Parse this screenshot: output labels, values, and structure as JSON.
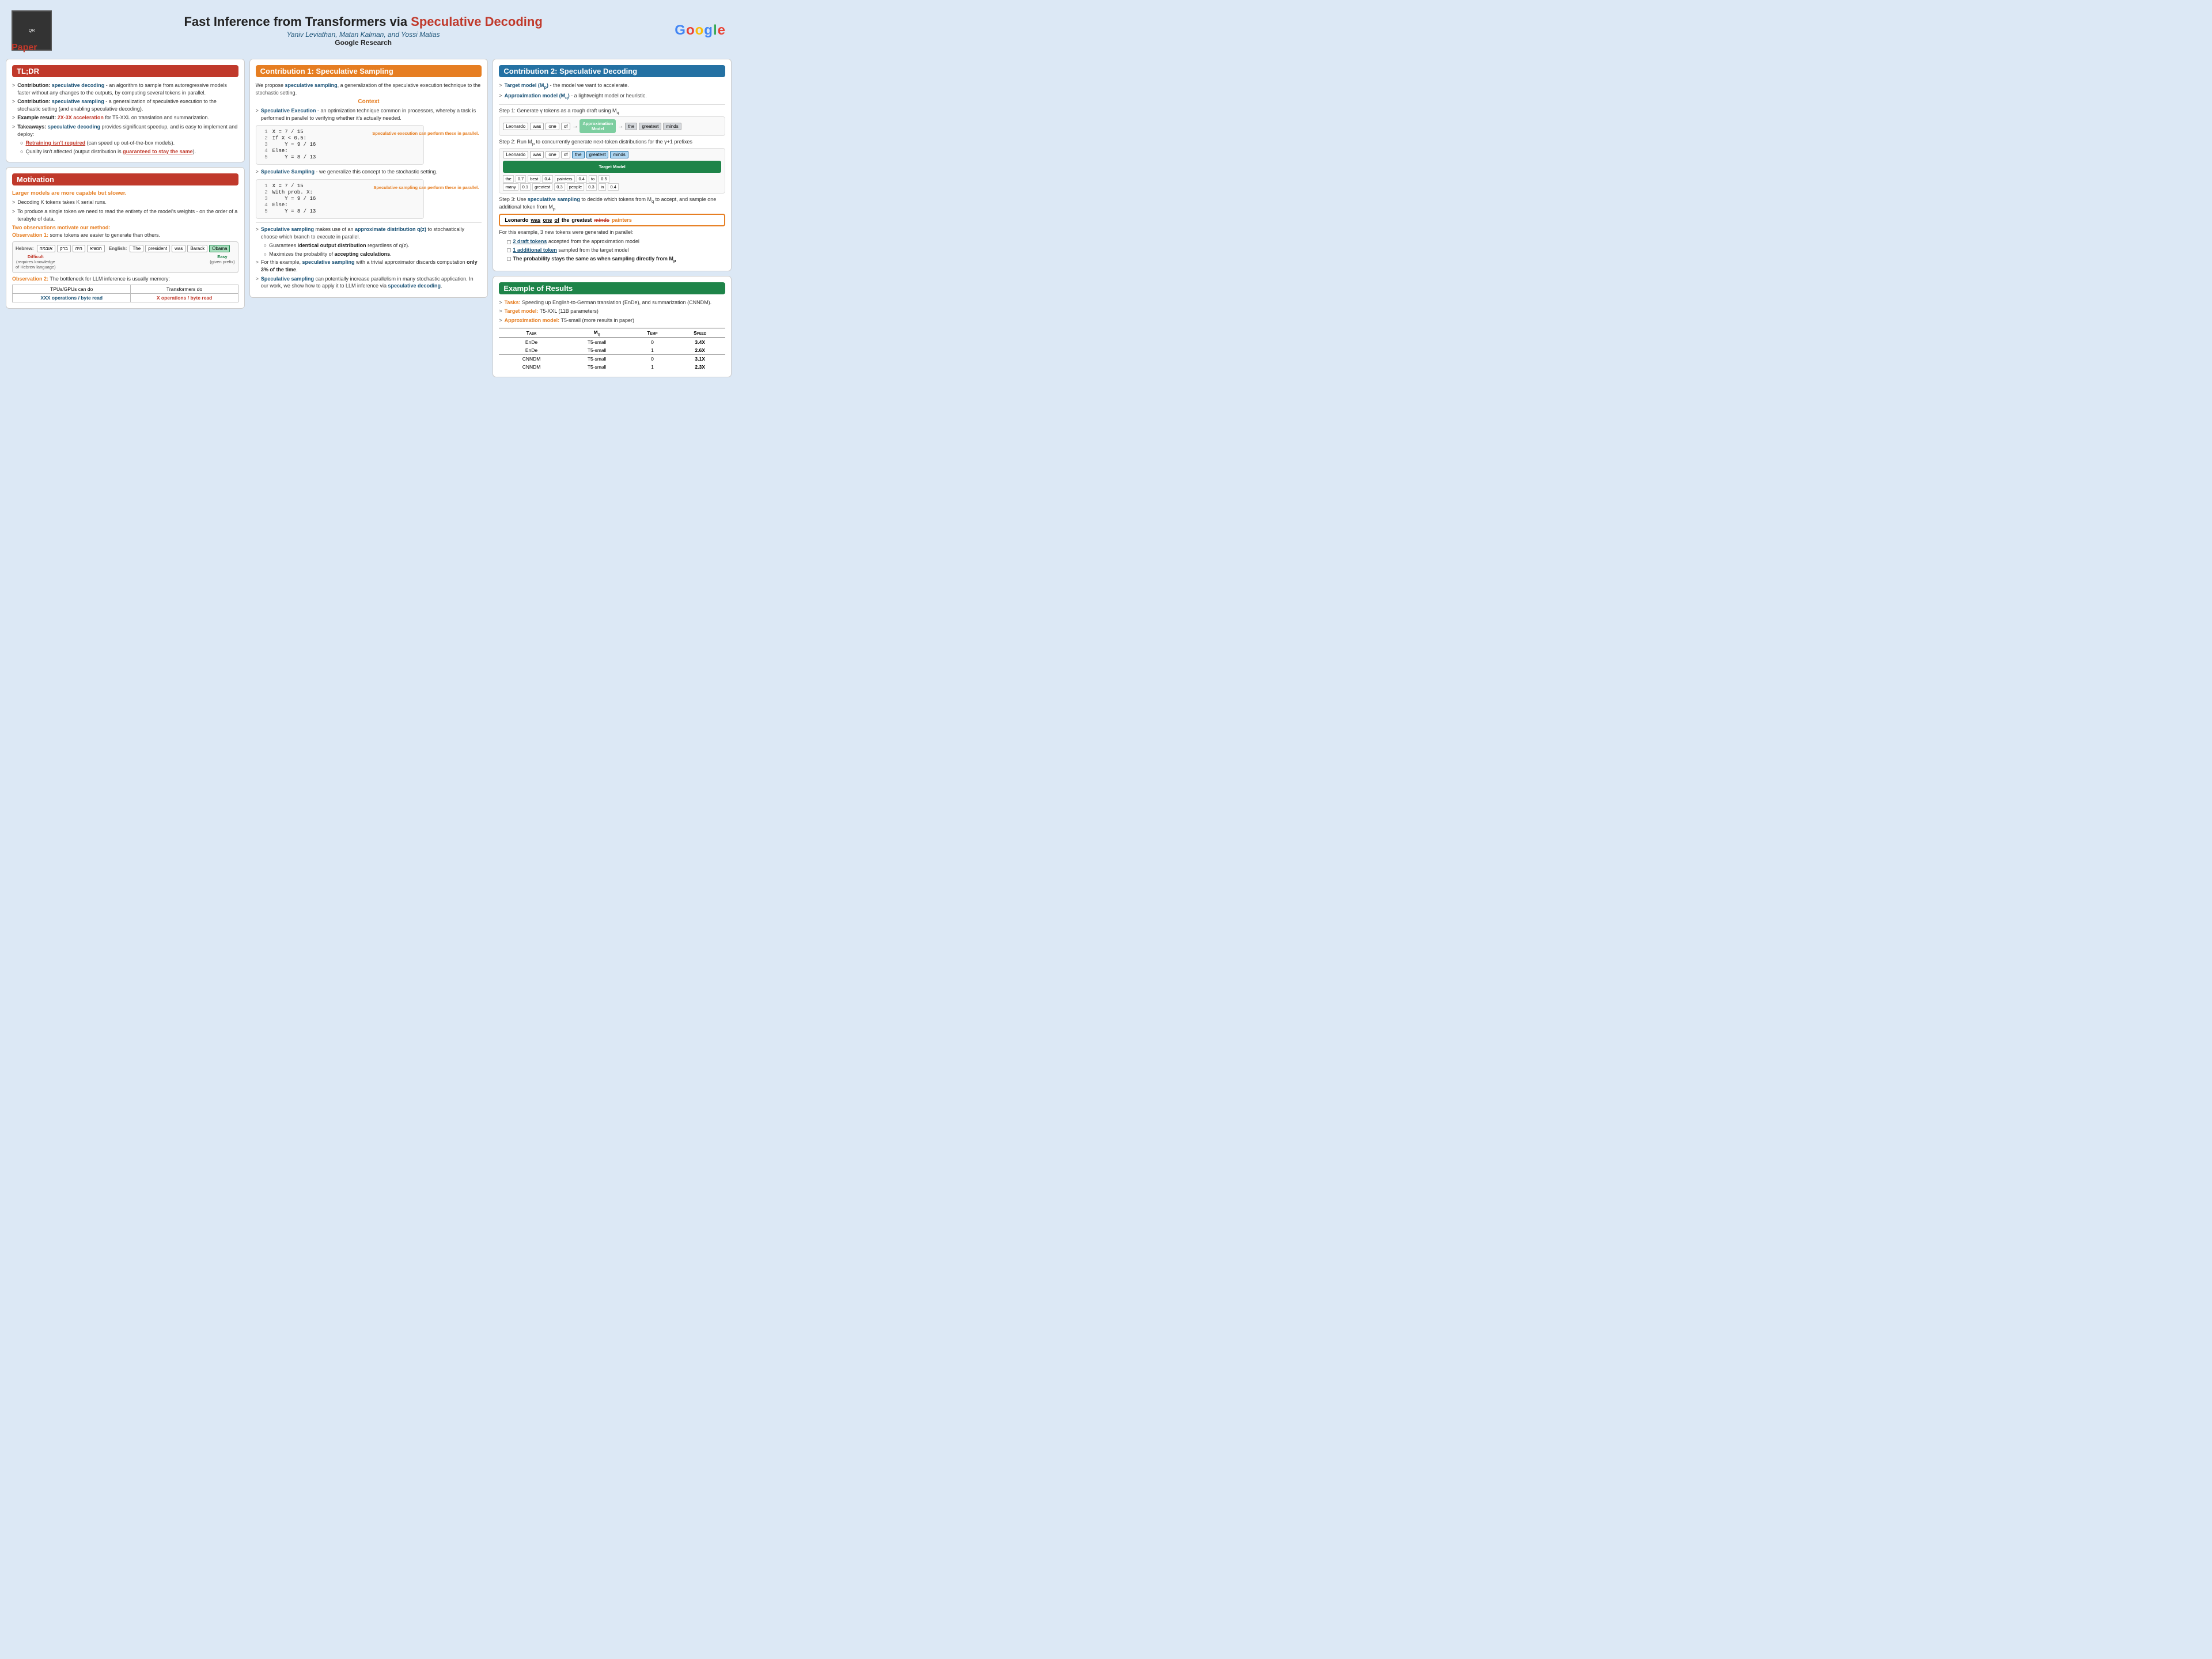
{
  "header": {
    "title_part1": "Fast Inference from Transformers via ",
    "title_part2": "Speculative Decoding",
    "authors": "Yaniv Leviathan, Matan Kalman, and Yossi Matias",
    "org": "Google Research",
    "paper_label": "Paper",
    "qr_alt": "QR code"
  },
  "tldr": {
    "header": "TL;DR",
    "bullets": [
      {
        "prefix": "Contribution: ",
        "prefix_color": "blue",
        "term": "speculative decoding",
        "rest": " - an algorithm to sample from autoregressive models faster without any changes to the outputs, by computing several tokens in parallel."
      },
      {
        "prefix": "Contribution: ",
        "prefix_color": "blue",
        "term": "speculative sampling",
        "rest": " - a generalization of speculative execution to the stochastic setting (and enabling speculative decoding)."
      },
      {
        "prefix": "Example result: ",
        "term": "2X-3X acceleration",
        "rest": " for T5-XXL on translation and summarization."
      },
      {
        "prefix": "Takeaways: ",
        "term": "speculative decoding",
        "rest": " provides significant speedup, and is easy to implement and deploy:"
      }
    ],
    "sub_bullets": [
      "Retraining isn't required (can speed up out-of-the-box models).",
      "Quality isn't affected (output distribution is guaranteed to stay the same)."
    ]
  },
  "motivation": {
    "header": "Motivation",
    "title": "Larger models are more capable but slower.",
    "bullets": [
      "Decoding K tokens takes K serial runs.",
      "To produce a single token we need to read the entirety of the model's weights - on the order of a terabyte of data."
    ],
    "obs_title": "Two observations motivate our method:",
    "obs1_label": "Observation 1:",
    "obs1_text": " some tokens are easier to generate than others.",
    "obs2_label": "Observation 2:",
    "obs2_text": " The bottleneck for LLM inference is usually memory:",
    "hebrew_label": "Hebrew:",
    "hebrew_tokens": [
      "אובמה",
      "ברק",
      "היה",
      "הנשיא"
    ],
    "english_label": "English:",
    "english_tokens": [
      "The",
      "president",
      "was",
      "Barack",
      "Obama"
    ],
    "difficult_label": "Difficult",
    "difficult_sub": "(requires knowledge of Hebrew language)",
    "easy_label": "Easy",
    "easy_sub": "(given prefix)",
    "table_col1": "TPUs/GPUs can do",
    "table_col2": "Transformers do",
    "table_r1c1": "XXX operations / byte read",
    "table_r1c2": "X operations / byte read"
  },
  "contribution1": {
    "header": "Contribution 1: Speculative Sampling",
    "intro": "We propose speculative sampling, a generalization of the speculative execution technique to the stochastic setting.",
    "intro_term": "speculative sampling",
    "context_label": "Context",
    "spec_exec_label": "Speculative Execution",
    "spec_exec_text": " - an optimization technique common in processors, whereby a task is performed in parallel to verifying whether it's actually needed.",
    "code1_lines": [
      {
        "num": "1",
        "text": "X = 7 / 15"
      },
      {
        "num": "2",
        "text": "If X < 0.5:"
      },
      {
        "num": "3",
        "text": "    Y = 9 / 16"
      },
      {
        "num": "4",
        "text": "Else:"
      },
      {
        "num": "5",
        "text": "    Y = 8 / 13"
      }
    ],
    "bracket1_label": "Speculative execution can perform these in parallel.",
    "spec_samp_label": "Speculative Sampling",
    "spec_samp_text": " - we generalize this concept to the stochastic setting.",
    "code2_lines": [
      {
        "num": "1",
        "text": "X = 7 / 15"
      },
      {
        "num": "2",
        "text": "With prob. X:"
      },
      {
        "num": "3",
        "text": "    Y = 9 / 16"
      },
      {
        "num": "4",
        "text": "Else:"
      },
      {
        "num": "5",
        "text": "    Y = 8 / 13"
      }
    ],
    "bracket2_label": "Speculative sampling can perform these in parallel.",
    "bullets_after": [
      {
        "term": "Speculative sampling",
        "rest": " makes use of an ",
        "term2": "approximate distribution q(z)",
        "rest2": " to stochastically choose which branch to execute in parallel."
      },
      {
        "sub1": "Guarantees ",
        "sub1_bold": "identical output distribution",
        "sub1_rest": " regardless of q(z).",
        "sub2": "Maximizes the probability of ",
        "sub2_bold": "accepting calculations",
        "sub2_rest": "."
      },
      {
        "term": "",
        "rest": "For this example, ",
        "term2": "speculative sampling",
        "rest2": " with a trivial approximator discards computation ",
        "bold_part": "only 3% of the time",
        "rest3": "."
      },
      {
        "term": "Speculative sampling",
        "rest": " can potentially increase parallelism in many stochastic application. In our work, we show how to apply it to LLM inference via ",
        "term2": "speculative decoding",
        "rest2": "."
      }
    ]
  },
  "contribution2": {
    "header": "Contribution 2: Speculative Decoding",
    "target_model": "Target model (Mp)",
    "target_model_desc": " - the model we want to accelerate.",
    "approx_model": "Approximation model (Mq)",
    "approx_model_desc": " - a lightweight model or heuristic.",
    "step1": "Step 1: Generate γ tokens as a rough draft using M",
    "step1_sub": "q",
    "step1_tokens": [
      "Leonardo",
      "was",
      "one",
      "of"
    ],
    "approx_model_box": "Approximation Model",
    "step1_output": [
      "the",
      "greatest",
      "minds"
    ],
    "step2": "Step 2: Run M",
    "step2_sub": "p",
    "step2_rest": " to concurrently generate next-token distributions for the γ+1 prefixes",
    "step2_top_tokens": [
      "Leonardo",
      "was",
      "one",
      "of",
      "the",
      "greatest",
      "minds"
    ],
    "target_model_box": "Target Model",
    "prob_rows": [
      [
        "the",
        "0.7",
        "best",
        "0.4",
        "painters",
        "0.4",
        "to",
        "0.5"
      ],
      [
        "many",
        "0.1",
        "greatest",
        "0.3",
        "people",
        "0.3",
        "in",
        "0.4"
      ]
    ],
    "step3": "Step 3: Use ",
    "step3_term": "speculative sampling",
    "step3_rest": " to decide which tokens from M",
    "step3_sub": "q",
    "step3_rest2": " to accept, and sample one additional token from M",
    "step3_sub2": "p",
    "result_tokens": [
      "Leonardo",
      "was",
      "one",
      "of",
      "the",
      "greatest",
      "minds",
      "painters"
    ],
    "result_colors": [
      "normal",
      "underline",
      "underline",
      "underline",
      "normal",
      "normal",
      "strikethrough",
      "orange"
    ],
    "for_example_text": "For this example, 3 new tokens were generated in parallel:",
    "example_bullets": [
      {
        "sq": true,
        "bold": "2 draft tokens",
        "rest": " accepted from the approximation model"
      },
      {
        "sq": true,
        "bold": "1 additional token",
        "rest": " sampled from the target model"
      },
      {
        "sq": true,
        "bold": "The probability stays the same as when sampling directly from M",
        "sub": "p"
      }
    ]
  },
  "results": {
    "header": "Example of Results",
    "bullets": [
      {
        "label": "Tasks:",
        "rest": " Speeding up English-to-German translation (EnDe), and summarization (CNNDM)."
      },
      {
        "label": "Target model:",
        "rest": " T5-XXL (11B parameters)"
      },
      {
        "label": "Approximation model:",
        "rest": " T5-small (more results in paper)"
      }
    ],
    "table_headers": [
      "Task",
      "Mq",
      "Temp",
      "Speed"
    ],
    "table_rows": [
      {
        "task": "EnDe",
        "mq": "T5-Small",
        "temp": "0",
        "speed": "3.4X",
        "border_top": false
      },
      {
        "task": "EnDe",
        "mq": "T5-Small",
        "temp": "1",
        "speed": "2.6X",
        "border_top": false
      },
      {
        "task": "CNNDM",
        "mq": "T5-Small",
        "temp": "0",
        "speed": "3.1X",
        "border_top": true
      },
      {
        "task": "CNNDM",
        "mq": "T5-Small",
        "temp": "1",
        "speed": "2.3X",
        "border_top": false
      }
    ]
  }
}
